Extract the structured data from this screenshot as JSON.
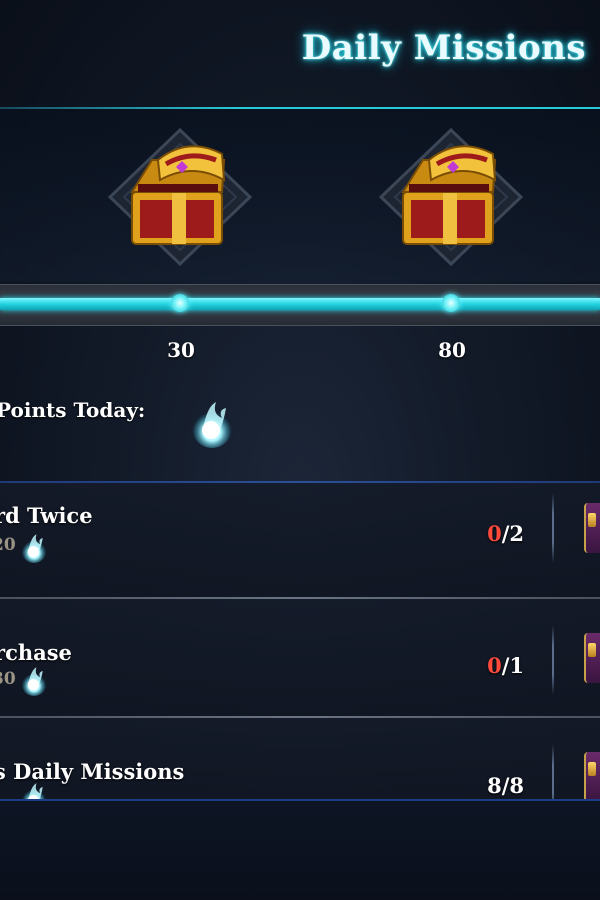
{
  "header": {
    "title": "Daily Missions"
  },
  "progress": {
    "fill_fraction": 1.0,
    "milestones": [
      {
        "label": "30"
      },
      {
        "label": "80"
      }
    ]
  },
  "points": {
    "label": "Points Today:"
  },
  "missions": [
    {
      "title": "rd Twice",
      "reward": "20",
      "current": "0",
      "total": "/2",
      "current_highlight": true
    },
    {
      "title": "rchase",
      "reward": "30",
      "current": "0",
      "total": "/1",
      "current_highlight": true
    },
    {
      "title": "s Daily Missions",
      "reward": "",
      "current": "8",
      "total": "/8",
      "current_highlight": false
    }
  ],
  "colors": {
    "accent": "#27d9e6",
    "incomplete": "#ff4a3c",
    "chest_gold": "#e0a21c",
    "chest_red": "#9e1b1b"
  },
  "icons": {
    "chest": "treasure-chest-icon",
    "points": "blue-flame-wisp-icon",
    "reward_item": "reward-item-icon"
  }
}
